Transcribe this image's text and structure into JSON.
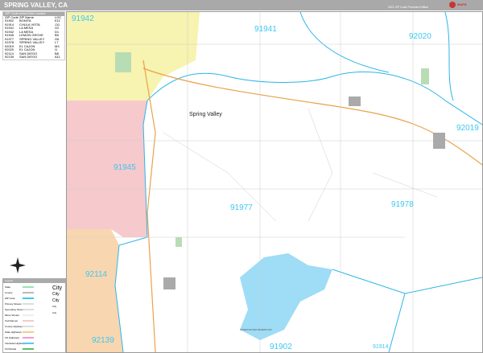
{
  "header": {
    "title": "SPRING VALLEY, CA",
    "edition": "2021 ZIP Code Premium Edition",
    "logo_text": "Market MAPS"
  },
  "index": {
    "heading": "ZIP Code Index/Grid Locator",
    "columns": [
      "ZIP Code",
      "ZIP Name",
      "LOC"
    ],
    "rows": [
      [
        "91902",
        "BONITA",
        "E11"
      ],
      [
        "91914",
        "CHULA VISTA",
        "J11"
      ],
      [
        "91941",
        "LA MESA",
        "G2"
      ],
      [
        "91942",
        "LA MESA",
        "D1"
      ],
      [
        "91945",
        "LEMON GROVE",
        "B5"
      ],
      [
        "91977",
        "SPRING VALLEY",
        "G6"
      ],
      [
        "91978",
        "SPRING VALLEY",
        "L7"
      ],
      [
        "92019",
        "EL CAJON",
        "M3"
      ],
      [
        "92020",
        "EL CAJON",
        "I1"
      ],
      [
        "92114",
        "SAN DIEGO",
        "B8"
      ],
      [
        "92139",
        "SAN DIEGO",
        "A11"
      ]
    ]
  },
  "map": {
    "zips": [
      {
        "code": "91942"
      },
      {
        "code": "91941"
      },
      {
        "code": "92020"
      },
      {
        "code": "92019"
      },
      {
        "code": "91945"
      },
      {
        "code": "91977"
      },
      {
        "code": "91978"
      },
      {
        "code": "92114"
      },
      {
        "code": "92139"
      },
      {
        "code": "91902"
      },
      {
        "code": "91914"
      }
    ],
    "city_label": "Spring Valley",
    "lake_label": "SWEETWATER RESERVOIR",
    "colors": {
      "zip_label": "#3ec8f0",
      "zip_boundary": "#2bb5e8",
      "yellow": "#f7f3b0",
      "pink": "#f6c9cc",
      "orange": "#f8d6b0",
      "water": "#9fdcf5"
    }
  },
  "legend": {
    "heading": "Legend",
    "items": [
      "State",
      "County",
      "ZIP Code",
      "Primary Streets",
      "Secondary Streets",
      "Minor Streets",
      "Civil Ramps",
      "County Highways",
      "State Highways",
      "US Highways",
      "Interstate Highways",
      "Toll Roads"
    ],
    "city_samples": [
      "City",
      "City",
      "City",
      "City",
      "City"
    ]
  }
}
